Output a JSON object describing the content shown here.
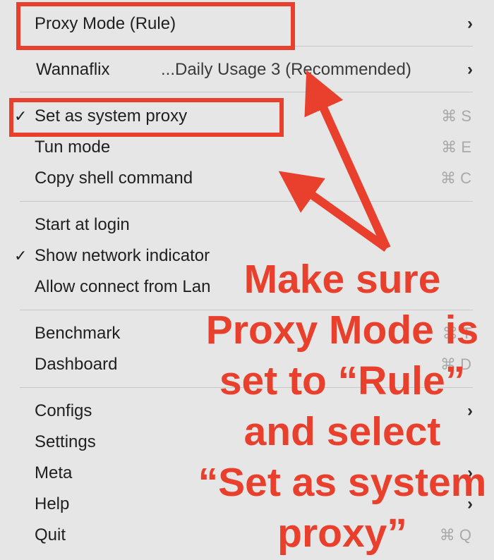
{
  "menu": {
    "proxy_mode": "Proxy Mode (Rule)",
    "wannaflix": "Wannaflix",
    "wannaflix_selection": "...Daily Usage 3 (Recommended)",
    "set_system_proxy": "Set as system proxy",
    "set_system_proxy_shortcut": "⌘ S",
    "tun_mode": "Tun mode",
    "tun_mode_shortcut": "⌘ E",
    "copy_shell": "Copy shell command",
    "copy_shell_shortcut": "⌘ C",
    "start_at_login": "Start at login",
    "show_network_indicator": "Show network indicator",
    "allow_lan": "Allow connect from Lan",
    "benchmark": "Benchmark",
    "benchmark_shortcut": "⌘ T",
    "dashboard": "Dashboard",
    "dashboard_shortcut": "⌘ D",
    "configs": "Configs",
    "settings": "Settings",
    "meta": "Meta",
    "help": "Help",
    "quit": "Quit",
    "quit_shortcut": "⌘ Q",
    "check_mark": "✓",
    "chevron": "›"
  },
  "annotation": {
    "line1": "Make sure",
    "line2": "Proxy Mode is",
    "line3": "set to “Rule”",
    "line4": "and select",
    "line5": "“Set as system",
    "line6": "proxy”"
  },
  "colors": {
    "annotation_red": "#e8402c",
    "menu_bg": "#e6e6e6"
  }
}
